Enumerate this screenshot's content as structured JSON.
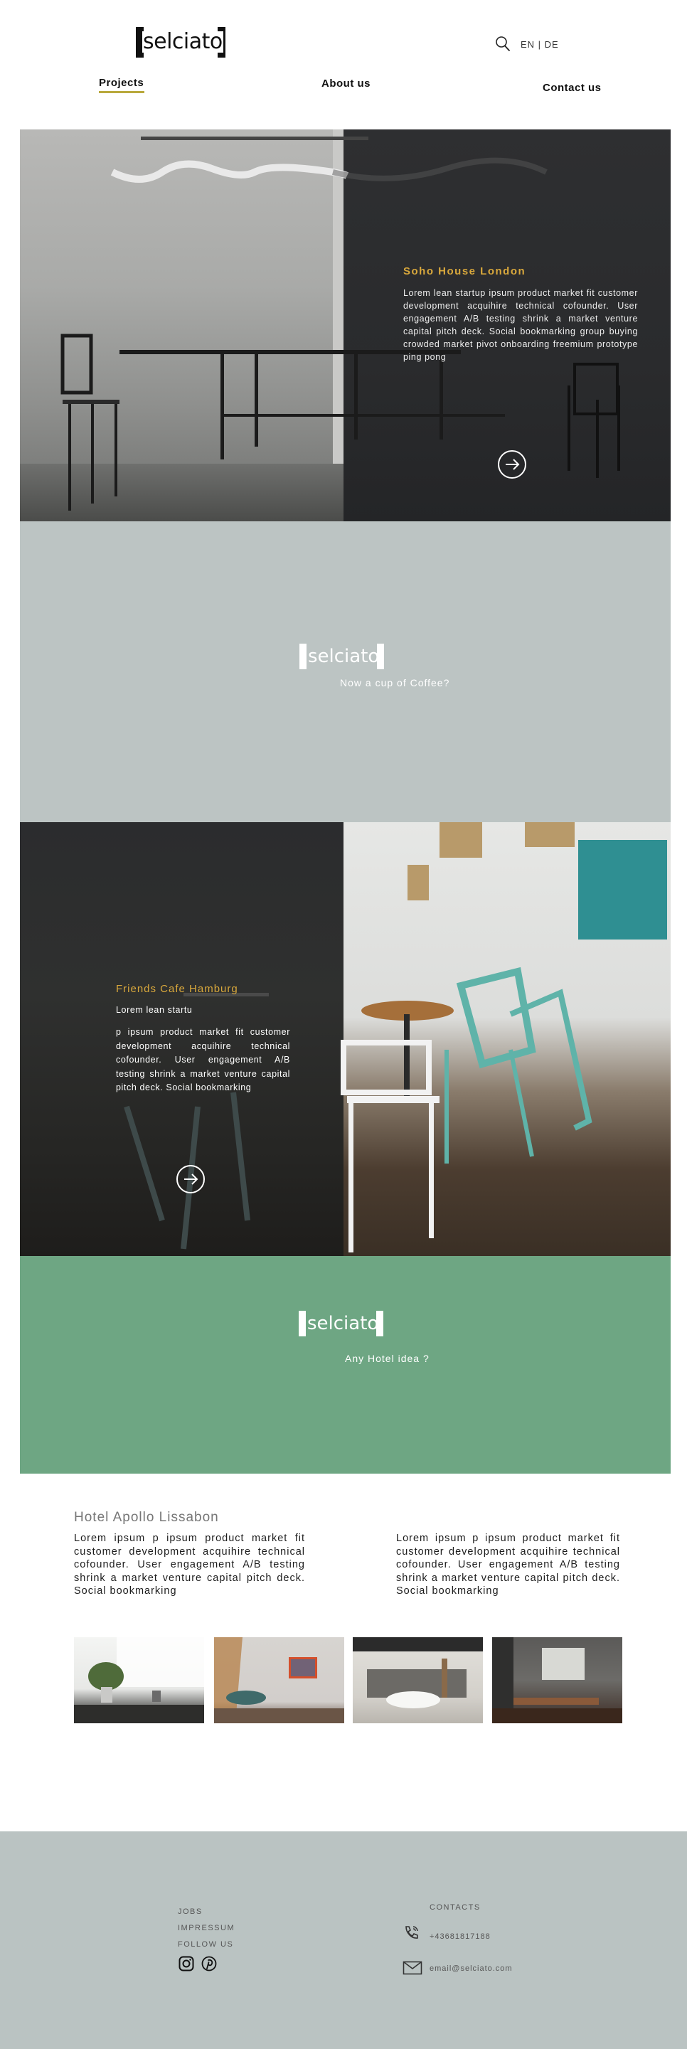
{
  "header": {
    "logo_text": "selciato",
    "language": "EN | DE",
    "nav": {
      "projects": "Projects",
      "about": "About us",
      "contact": "Contact us"
    },
    "icons": {
      "search": "search-icon"
    }
  },
  "hero1": {
    "title": "Soho House London",
    "body": "Lorem lean startup ipsum product market fit customer development acquihire technical cofounder. User engagement A/B testing shrink a market venture capital pitch deck. Social bookmarking group buying crowded market pivot onboarding freemium prototype ping pong",
    "icon": "arrow-right-circle-icon"
  },
  "coffee_band": {
    "logo_text": "selciato",
    "tagline": "Now a cup of Coffee?",
    "color": "#bcc4c3"
  },
  "hero2": {
    "title": "Friends Cafe Hamburg",
    "subtitle": "Lorem lean startu",
    "body": "p ipsum product market fit customer development acquihire technical cofounder. User engagement A/B testing shrink a market venture capital pitch deck. Social bookmarking",
    "icon": "arrow-right-circle-icon"
  },
  "hotel_band": {
    "logo_text": "selciato",
    "tagline": "Any Hotel idea ?",
    "color": "#6ea683"
  },
  "apollo": {
    "title": "Hotel Apollo Lissabon",
    "col1": "Lorem ipsum p ipsum product market fit customer development acquihire technical cofounder. User engagement A/B testing shrink a market venture capital pitch deck. Social bookmarking",
    "col2": "Lorem ipsum p ipsum product market fit customer development acquihire technical cofounder. User engagement A/B testing shrink a market venture capital pitch deck. Social bookmarking"
  },
  "footer": {
    "links": [
      "JOBS",
      "IMPRESSUM",
      "FOLLOW US"
    ],
    "social_icons": [
      "instagram-icon",
      "pinterest-icon"
    ],
    "contacts_heading": "CONTACTS",
    "phone": "+43681817188",
    "email": "email@selciato.com",
    "color": "#bac3c2"
  },
  "colors": {
    "accent_gold": "#d9a83c",
    "nav_underline": "#b9a93c"
  }
}
